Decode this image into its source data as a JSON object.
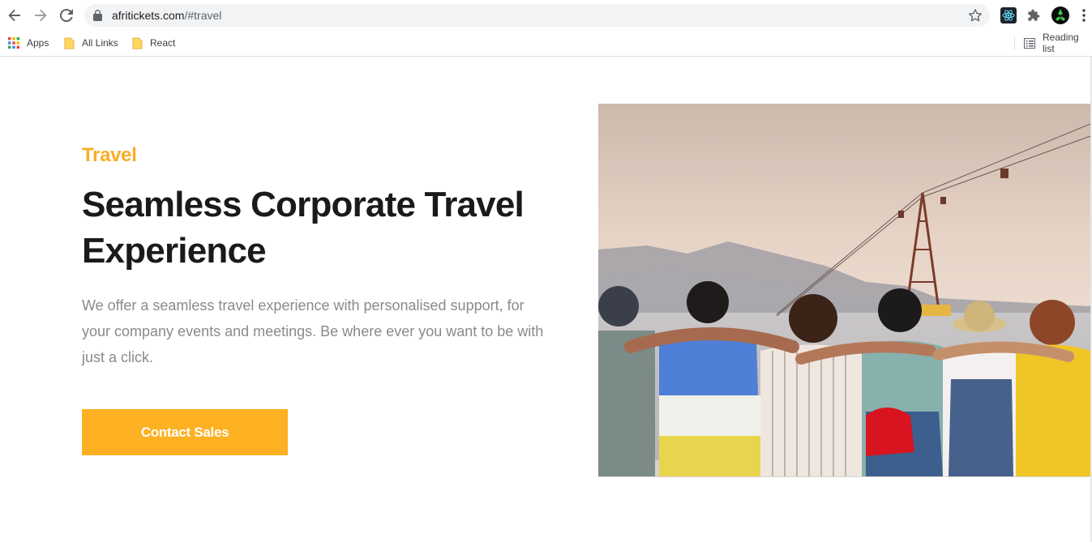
{
  "browser": {
    "url_host": "afritickets.com",
    "url_path": "/#travel",
    "bookmarks": [
      "Apps",
      "All Links",
      "React"
    ],
    "reading_list": "Reading list"
  },
  "hero": {
    "eyebrow": "Travel",
    "headline": "Seamless Corporate Travel Experience",
    "description": "We offer a seamless travel experience with personalised support, for your company events and meetings. Be where ever you want to be with just a click.",
    "cta_label": "Contact Sales"
  },
  "colors": {
    "accent": "#f9ad24",
    "button": "#fdb022",
    "headline": "#1a1a1a",
    "body_text": "#8a8a8a"
  },
  "icons": [
    "back-icon",
    "forward-icon",
    "reload-icon",
    "lock-icon",
    "bookmark-star-icon",
    "react-devtools-icon",
    "extensions-icon",
    "profile-avatar-icon",
    "menu-icon",
    "apps-grid-icon",
    "folder-icon",
    "reading-list-icon"
  ]
}
